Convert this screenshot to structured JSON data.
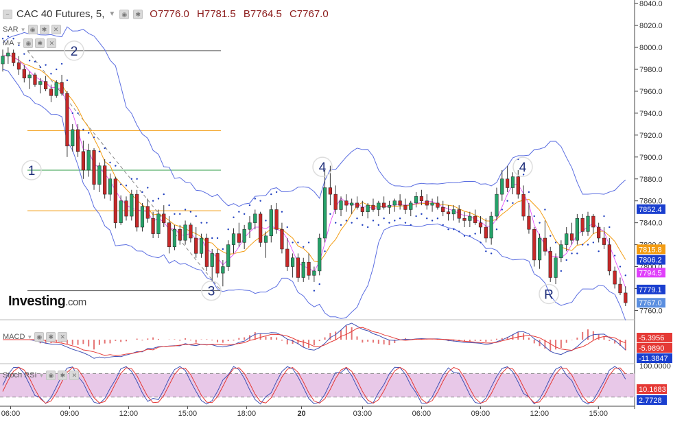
{
  "header": {
    "title": "CAC 40 Futures, 5,",
    "open": "O7776.0",
    "high": "H7781.5",
    "low": "B7764.5",
    "close": "C7767.0"
  },
  "indicators": {
    "sar": "SAR",
    "ma": "MA",
    "macd": "MACD",
    "stoch": "Stoch RSI"
  },
  "logo": {
    "main": "Investing",
    "suffix": ".com"
  },
  "colors": {
    "up": "#26a269",
    "down": "#c62828",
    "bollinger": "#5b6ee1",
    "sar": "#1f3fbf",
    "ma_orange": "#f39c12",
    "ma_magenta": "#e040fb",
    "fib_green": "#2e9e44",
    "fib_orange": "#f39c12",
    "macd_line": "#3f51b5",
    "signal_line": "#e53935",
    "stoch_fill": "#e8c8e8"
  },
  "chart_data": {
    "type": "candlestick",
    "y_range": [
      7754,
      8042
    ],
    "y_ticks": [
      7760.0,
      7780.0,
      7800.0,
      7820.0,
      7840.0,
      7860.0,
      7880.0,
      7900.0,
      7920.0,
      7940.0,
      7960.0,
      7980.0,
      8000.0,
      8020.0,
      8040.0
    ],
    "x_labels": [
      "06:00",
      "09:00",
      "12:00",
      "15:00",
      "18:00",
      "20",
      "03:00",
      "06:00",
      "09:00",
      "12:00",
      "15:00"
    ],
    "x_label_positions": [
      0.4,
      3.4,
      6.4,
      9.4,
      12.4,
      15.2,
      18.3,
      21.3,
      24.3,
      27.3,
      30.3
    ],
    "candles": [
      [
        0.0,
        7985,
        7998,
        7978,
        7992
      ],
      [
        0.13,
        7992,
        8000,
        7985,
        7995
      ],
      [
        0.26,
        7995,
        7998,
        7983,
        7986
      ],
      [
        0.39,
        7986,
        7992,
        7975,
        7980
      ],
      [
        0.52,
        7980,
        7984,
        7968,
        7972
      ],
      [
        0.65,
        7972,
        7978,
        7962,
        7975
      ],
      [
        0.78,
        7975,
        7977,
        7964,
        7966
      ],
      [
        0.91,
        7966,
        7972,
        7958,
        7969
      ],
      [
        1.04,
        7969,
        7974,
        7960,
        7962
      ],
      [
        1.17,
        7962,
        7966,
        7950,
        7956
      ],
      [
        1.3,
        7956,
        7970,
        7954,
        7968
      ],
      [
        1.43,
        7968,
        7975,
        7956,
        7958
      ],
      [
        1.56,
        7958,
        7960,
        7900,
        7910
      ],
      [
        1.69,
        7910,
        7930,
        7905,
        7925
      ],
      [
        1.82,
        7925,
        7930,
        7900,
        7905
      ],
      [
        1.95,
        7905,
        7915,
        7880,
        7888
      ],
      [
        2.08,
        7888,
        7912,
        7882,
        7906
      ],
      [
        2.21,
        7906,
        7908,
        7870,
        7875
      ],
      [
        2.34,
        7875,
        7895,
        7868,
        7892
      ],
      [
        2.47,
        7892,
        7898,
        7862,
        7866
      ],
      [
        2.6,
        7866,
        7885,
        7860,
        7880
      ],
      [
        2.73,
        7880,
        7882,
        7835,
        7840
      ],
      [
        2.86,
        7840,
        7865,
        7838,
        7860
      ],
      [
        2.99,
        7860,
        7864,
        7842,
        7846
      ],
      [
        3.12,
        7846,
        7870,
        7842,
        7866
      ],
      [
        3.25,
        7866,
        7870,
        7832,
        7836
      ],
      [
        3.38,
        7836,
        7858,
        7832,
        7855
      ],
      [
        3.51,
        7855,
        7862,
        7840,
        7844
      ],
      [
        3.64,
        7844,
        7850,
        7826,
        7830
      ],
      [
        3.77,
        7830,
        7852,
        7826,
        7848
      ],
      [
        3.9,
        7848,
        7856,
        7836,
        7840
      ],
      [
        4.03,
        7840,
        7846,
        7812,
        7818
      ],
      [
        4.16,
        7818,
        7838,
        7815,
        7834
      ],
      [
        4.29,
        7834,
        7838,
        7820,
        7824
      ],
      [
        4.42,
        7824,
        7842,
        7820,
        7838
      ],
      [
        4.55,
        7838,
        7840,
        7822,
        7826
      ],
      [
        4.68,
        7826,
        7836,
        7808,
        7812
      ],
      [
        4.81,
        7812,
        7830,
        7808,
        7826
      ],
      [
        4.94,
        7826,
        7830,
        7796,
        7800
      ],
      [
        5.07,
        7800,
        7816,
        7786,
        7812
      ],
      [
        5.2,
        7812,
        7816,
        7790,
        7794
      ],
      [
        5.33,
        7794,
        7806,
        7782,
        7800
      ],
      [
        5.46,
        7800,
        7824,
        7796,
        7820
      ],
      [
        5.59,
        7820,
        7835,
        7812,
        7830
      ],
      [
        5.72,
        7830,
        7840,
        7818,
        7822
      ],
      [
        5.85,
        7822,
        7838,
        7816,
        7834
      ],
      [
        5.98,
        7834,
        7846,
        7826,
        7840
      ],
      [
        6.11,
        7840,
        7852,
        7834,
        7848
      ],
      [
        6.24,
        7848,
        7850,
        7818,
        7822
      ],
      [
        6.37,
        7822,
        7832,
        7808,
        7828
      ],
      [
        6.5,
        7828,
        7856,
        7822,
        7852
      ],
      [
        6.63,
        7852,
        7858,
        7830,
        7834
      ],
      [
        6.76,
        7834,
        7840,
        7812,
        7816
      ],
      [
        6.89,
        7816,
        7826,
        7796,
        7800
      ],
      [
        7.02,
        7800,
        7812,
        7790,
        7808
      ],
      [
        7.15,
        7808,
        7812,
        7786,
        7790
      ],
      [
        7.28,
        7790,
        7808,
        7786,
        7804
      ],
      [
        7.41,
        7804,
        7812,
        7788,
        7792
      ],
      [
        7.54,
        7792,
        7800,
        7786,
        7796
      ],
      [
        7.67,
        7796,
        7830,
        7792,
        7826
      ],
      [
        7.8,
        7826,
        7888,
        7822,
        7872
      ],
      [
        7.93,
        7872,
        7892,
        7856,
        7866
      ],
      [
        8.06,
        7866,
        7874,
        7848,
        7852
      ],
      [
        8.19,
        7852,
        7864,
        7846,
        7860
      ],
      [
        8.32,
        7860,
        7866,
        7850,
        7856
      ],
      [
        8.45,
        7856,
        7862,
        7848,
        7858
      ],
      [
        8.58,
        7858,
        7864,
        7852,
        7854
      ],
      [
        8.71,
        7854,
        7860,
        7846,
        7850
      ],
      [
        8.84,
        7850,
        7858,
        7844,
        7856
      ],
      [
        8.97,
        7856,
        7862,
        7850,
        7852
      ],
      [
        9.1,
        7852,
        7860,
        7846,
        7858
      ],
      [
        9.23,
        7858,
        7864,
        7852,
        7854
      ],
      [
        9.36,
        7854,
        7860,
        7848,
        7856
      ],
      [
        9.49,
        7856,
        7862,
        7850,
        7860
      ],
      [
        9.62,
        7860,
        7866,
        7852,
        7856
      ],
      [
        9.75,
        7856,
        7862,
        7848,
        7852
      ],
      [
        9.88,
        7852,
        7860,
        7846,
        7858
      ],
      [
        10.01,
        7858,
        7868,
        7854,
        7864
      ],
      [
        10.14,
        7864,
        7870,
        7856,
        7860
      ],
      [
        10.27,
        7860,
        7866,
        7852,
        7856
      ],
      [
        10.4,
        7856,
        7862,
        7850,
        7858
      ],
      [
        10.53,
        7858,
        7864,
        7852,
        7854
      ],
      [
        10.66,
        7854,
        7860,
        7846,
        7850
      ],
      [
        10.79,
        7850,
        7856,
        7842,
        7848
      ],
      [
        10.92,
        7848,
        7856,
        7842,
        7852
      ],
      [
        11.05,
        7852,
        7856,
        7840,
        7844
      ],
      [
        11.18,
        7844,
        7850,
        7836,
        7842
      ],
      [
        11.31,
        7842,
        7850,
        7836,
        7846
      ],
      [
        11.44,
        7846,
        7852,
        7838,
        7840
      ],
      [
        11.57,
        7840,
        7846,
        7830,
        7836
      ],
      [
        11.7,
        7836,
        7844,
        7822,
        7826
      ],
      [
        11.83,
        7826,
        7850,
        7820,
        7846
      ],
      [
        11.96,
        7846,
        7872,
        7842,
        7866
      ],
      [
        12.09,
        7866,
        7888,
        7860,
        7880
      ],
      [
        12.22,
        7880,
        7892,
        7868,
        7872
      ],
      [
        12.35,
        7872,
        7886,
        7866,
        7882
      ],
      [
        12.48,
        7882,
        7888,
        7862,
        7866
      ],
      [
        12.61,
        7866,
        7874,
        7842,
        7846
      ],
      [
        12.74,
        7846,
        7858,
        7830,
        7834
      ],
      [
        12.87,
        7834,
        7836,
        7800,
        7806
      ],
      [
        13.0,
        7806,
        7830,
        7798,
        7826
      ],
      [
        13.13,
        7826,
        7842,
        7810,
        7814
      ],
      [
        13.26,
        7814,
        7818,
        7786,
        7790
      ],
      [
        13.39,
        7790,
        7812,
        7784,
        7808
      ],
      [
        13.52,
        7808,
        7824,
        7804,
        7820
      ],
      [
        13.65,
        7820,
        7836,
        7814,
        7830
      ],
      [
        13.78,
        7830,
        7840,
        7820,
        7824
      ],
      [
        13.91,
        7824,
        7848,
        7820,
        7844
      ],
      [
        14.04,
        7844,
        7848,
        7828,
        7832
      ],
      [
        14.17,
        7832,
        7850,
        7828,
        7846
      ],
      [
        14.3,
        7846,
        7848,
        7830,
        7836
      ],
      [
        14.43,
        7836,
        7840,
        7822,
        7826
      ],
      [
        14.56,
        7826,
        7836,
        7816,
        7820
      ],
      [
        14.69,
        7820,
        7826,
        7792,
        7796
      ],
      [
        14.82,
        7796,
        7800,
        7780,
        7784
      ],
      [
        14.95,
        7784,
        7790,
        7774,
        7776
      ],
      [
        15.08,
        7776,
        7782,
        7764,
        7767
      ]
    ],
    "fib_levels": [
      {
        "price": 7997,
        "color": "#555555"
      },
      {
        "price": 7924,
        "color": "#f39c12"
      },
      {
        "price": 7888,
        "color": "#2e9e44"
      },
      {
        "price": 7851,
        "color": "#f39c12"
      },
      {
        "price": 7778,
        "color": "#555555"
      }
    ],
    "wave_labels": [
      {
        "text": "2",
        "x": 4.45,
        "price": 7997
      },
      {
        "text": "1",
        "x": 1.8,
        "price": 7888
      },
      {
        "text": "3",
        "x": 12.6,
        "price": 7778
      },
      {
        "text": "4",
        "x": 19.0,
        "price": 7891
      },
      {
        "text": "4",
        "x": 31.2,
        "price": 7891
      },
      {
        "text": "R",
        "x": 32.5,
        "price": 7775
      }
    ],
    "price_tags": [
      {
        "label": "7852.4",
        "price": 7852.4,
        "color": "#1a3fcf"
      },
      {
        "label": "7815.8",
        "price": 7815.8,
        "color": "#f39c12"
      },
      {
        "label": "7806.2",
        "price": 7806.2,
        "color": "#1a3fcf"
      },
      {
        "label": "7794.5",
        "price": 7794.5,
        "color": "#e040fb"
      },
      {
        "label": "7779.1",
        "price": 7779.1,
        "color": "#1a3fcf"
      },
      {
        "label": "7767.0",
        "price": 7767.0,
        "color": "#5b8fe0"
      }
    ],
    "macd_tags": [
      {
        "label": "-5.3956",
        "value": -5.3956,
        "color": "#e53935"
      },
      {
        "label": "-5.9890",
        "value": -5.989,
        "color": "#e53935"
      },
      {
        "label": "-11.3847",
        "value": -11.3847,
        "color": "#1a3fcf"
      }
    ],
    "macd_range": [
      -20,
      14
    ],
    "stoch_ticks": [
      {
        "label": "100.0000",
        "value": 100
      }
    ],
    "stoch_tags": [
      {
        "label": "10.1683",
        "value": 40,
        "color": "#e53935"
      },
      {
        "label": "2.7728",
        "value": 8,
        "color": "#1a3fcf"
      }
    ],
    "stoch_levels": [
      80,
      20
    ]
  }
}
